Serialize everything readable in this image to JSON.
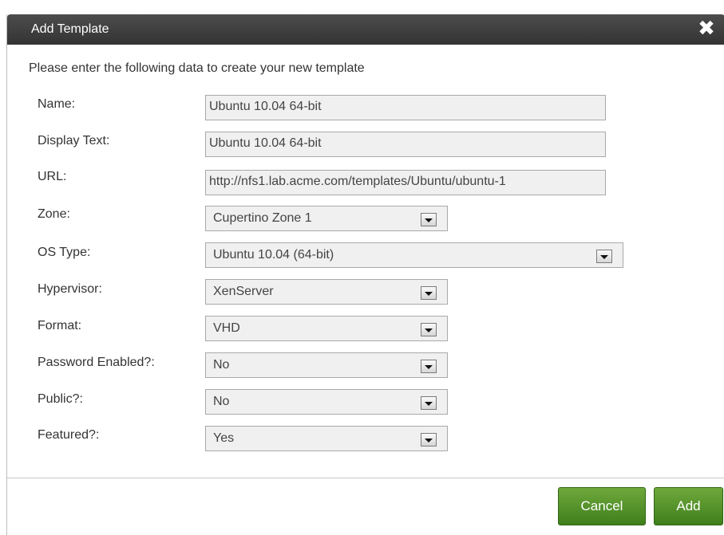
{
  "dialog": {
    "title": "Add Template",
    "close_icon": "close-icon",
    "intro": "Please enter the following data to create your new template"
  },
  "form": {
    "name": {
      "label": "Name:",
      "value": "Ubuntu 10.04 64-bit"
    },
    "display_text": {
      "label": "Display Text:",
      "value": "Ubuntu 10.04 64-bit"
    },
    "url": {
      "label": "URL:",
      "value": "http://nfs1.lab.acme.com/templates/Ubuntu/ubuntu-1"
    },
    "zone": {
      "label": "Zone:",
      "value": "Cupertino Zone 1"
    },
    "os_type": {
      "label": "OS Type:",
      "value": "Ubuntu 10.04 (64-bit)"
    },
    "hypervisor": {
      "label": "Hypervisor:",
      "value": "XenServer"
    },
    "format": {
      "label": "Format:",
      "value": "VHD"
    },
    "password_enabled": {
      "label": "Password Enabled?:",
      "value": "No"
    },
    "public": {
      "label": "Public?:",
      "value": "No"
    },
    "featured": {
      "label": "Featured?:",
      "value": "Yes"
    }
  },
  "buttons": {
    "cancel": "Cancel",
    "add": "Add"
  },
  "colors": {
    "titlebar": "#3f3f3f",
    "button_green": "#4f8f28",
    "field_bg": "#f0f0f0"
  }
}
